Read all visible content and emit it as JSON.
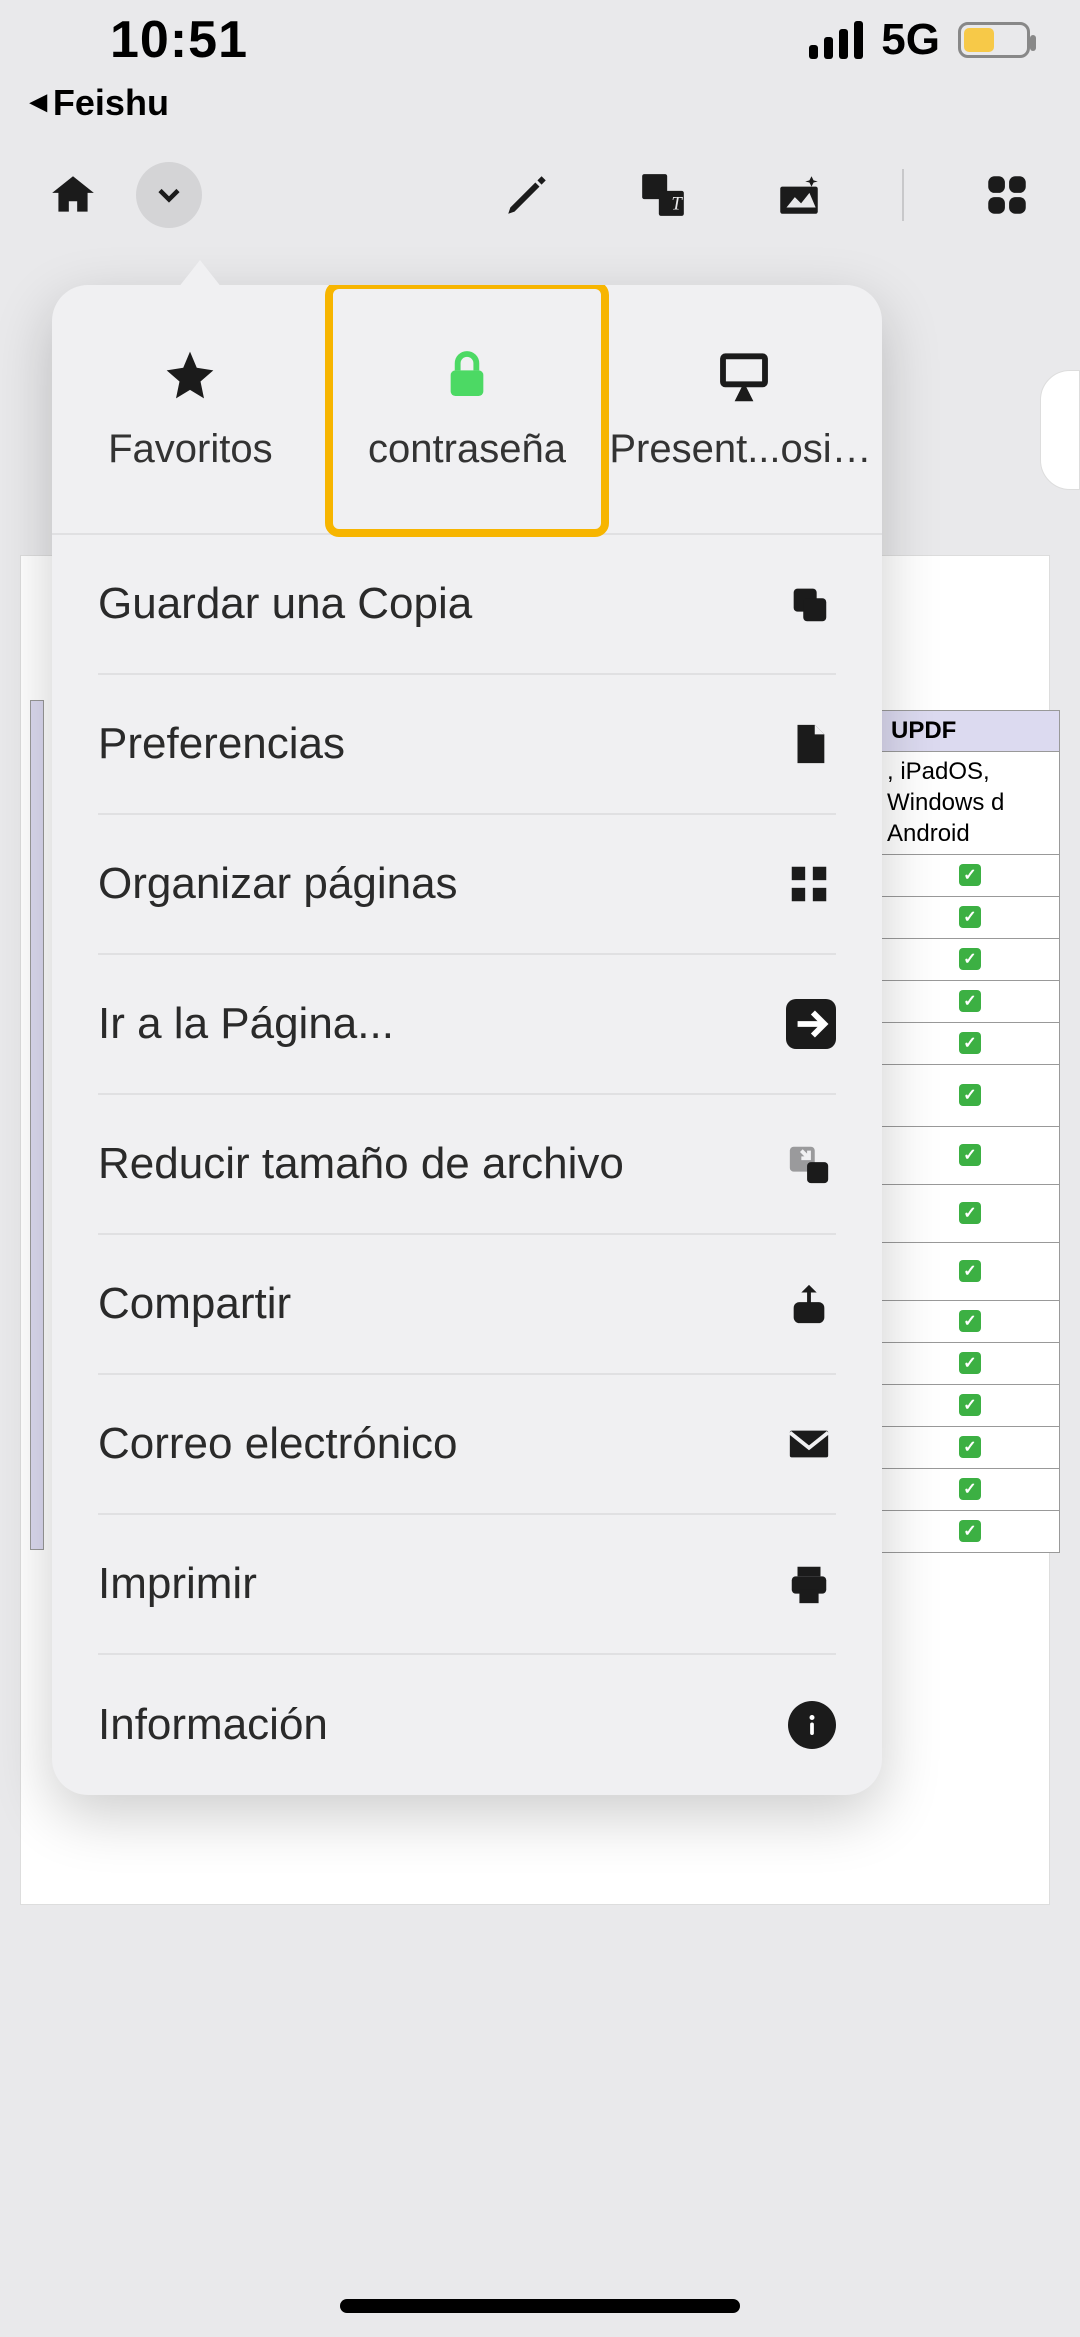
{
  "status": {
    "time": "10:51",
    "back_app": "Feishu",
    "network": "5G"
  },
  "popup_tabs": {
    "favorites": "Favoritos",
    "password": "contraseña",
    "slideshow": "Present...ositivas"
  },
  "menu": {
    "save_copy": "Guardar una Copia",
    "preferences": "Preferencias",
    "organize": "Organizar páginas",
    "goto": "Ir a la Página...",
    "reduce": "Reducir tamaño de archivo",
    "share": "Compartir",
    "email": "Correo electrónico",
    "print": "Imprimir",
    "info": "Información"
  },
  "doc_bg": {
    "header": "UPDF",
    "subheader": ", iPadOS, Windows d Android"
  }
}
